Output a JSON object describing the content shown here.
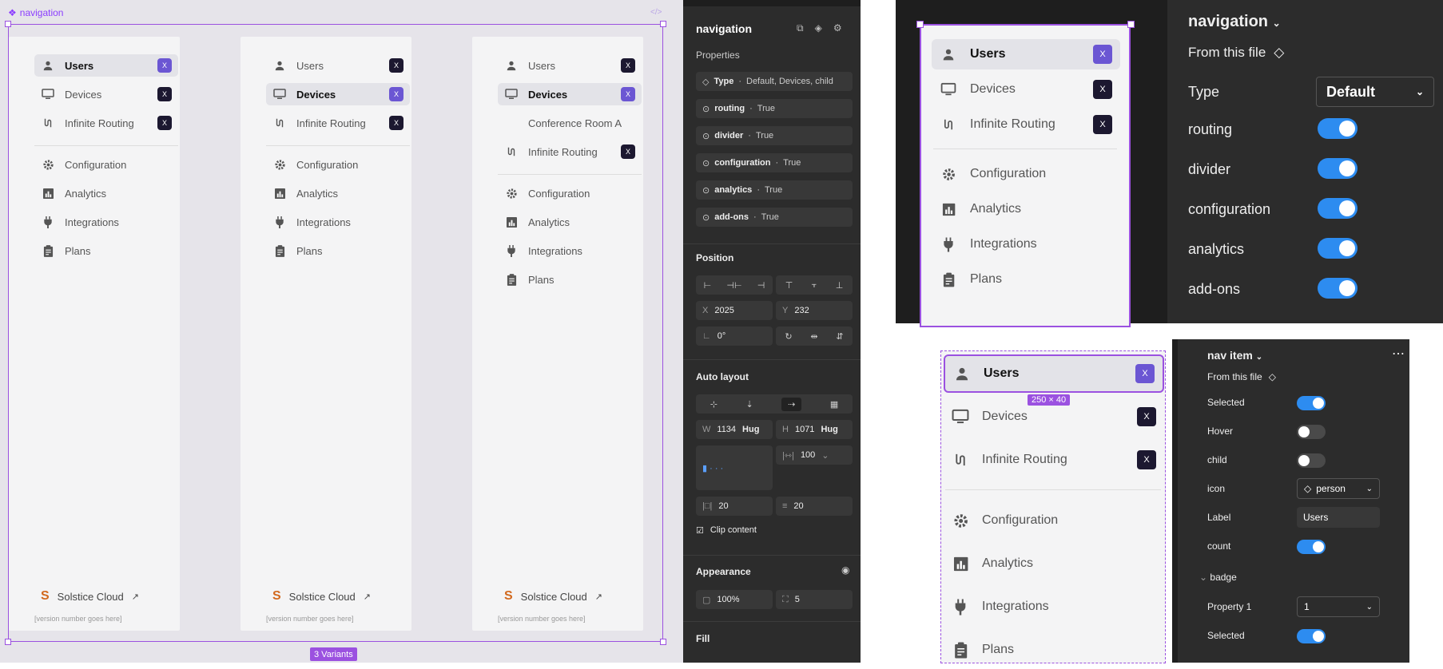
{
  "canvas": {
    "frame_name": "navigation",
    "variants_label": "3 Variants",
    "variants": [
      {
        "items": [
          {
            "label": "Users",
            "icon": "person-icon",
            "badge": "X",
            "selected": true
          },
          {
            "label": "Devices",
            "icon": "monitor-icon",
            "badge": "X",
            "selected": false
          },
          {
            "label": "Infinite Routing",
            "icon": "routing-icon",
            "badge": "X",
            "selected": false
          }
        ],
        "extra": []
      },
      {
        "items": [
          {
            "label": "Users",
            "icon": "person-icon",
            "badge": "X",
            "selected": false
          },
          {
            "label": "Devices",
            "icon": "monitor-icon",
            "badge": "X",
            "selected": true
          },
          {
            "label": "Infinite Routing",
            "icon": "routing-icon",
            "badge": "X",
            "selected": false
          }
        ]
      },
      {
        "items": [
          {
            "label": "Users",
            "icon": "person-icon",
            "badge": "X",
            "selected": false
          },
          {
            "label": "Devices",
            "icon": "monitor-icon",
            "badge": "X",
            "selected": true
          },
          {
            "label": "Conference Room A",
            "icon": "",
            "badge": "",
            "selected": false
          },
          {
            "label": "Infinite Routing",
            "icon": "routing-icon",
            "badge": "X",
            "selected": false
          }
        ]
      }
    ],
    "secondary_items": [
      {
        "label": "Configuration",
        "icon": "gear-icon"
      },
      {
        "label": "Analytics",
        "icon": "analytics-icon"
      },
      {
        "label": "Integrations",
        "icon": "plug-icon"
      },
      {
        "label": "Plans",
        "icon": "clipboard-icon"
      }
    ],
    "footer_brand": "Solstice Cloud",
    "version_text": "[version number goes here]"
  },
  "inspector": {
    "title": "navigation",
    "properties_heading": "Properties",
    "properties": [
      {
        "key": "Type",
        "value": "Default, Devices, child",
        "icon": "diamond-icon"
      },
      {
        "key": "routing",
        "value": "True",
        "icon": "toggle-icon"
      },
      {
        "key": "divider",
        "value": "True",
        "icon": "toggle-icon"
      },
      {
        "key": "configuration",
        "value": "True",
        "icon": "toggle-icon"
      },
      {
        "key": "analytics",
        "value": "True",
        "icon": "toggle-icon"
      },
      {
        "key": "add-ons",
        "value": "True",
        "icon": "toggle-icon"
      }
    ],
    "position_heading": "Position",
    "x_label": "X",
    "x_value": "2025",
    "y_label": "Y",
    "y_value": "232",
    "rotation": "0°",
    "auto_layout_heading": "Auto layout",
    "w_label": "W",
    "w_value": "1134",
    "w_mode": "Hug",
    "h_label": "H",
    "h_value": "1071",
    "h_mode": "Hug",
    "gap_value": "100",
    "pad_h": "20",
    "pad_v": "20",
    "clip_content": "Clip content",
    "appearance_heading": "Appearance",
    "opacity": "100%",
    "radius": "5",
    "fill_heading": "Fill"
  },
  "zoom_a": {
    "items": [
      {
        "label": "Users",
        "icon": "person-icon",
        "badge": "X",
        "selected": true
      },
      {
        "label": "Devices",
        "icon": "monitor-icon",
        "badge": "X"
      },
      {
        "label": "Infinite Routing",
        "icon": "routing-icon",
        "badge": "X"
      }
    ],
    "secondary": [
      {
        "label": "Configuration",
        "icon": "gear-icon"
      },
      {
        "label": "Analytics",
        "icon": "analytics-icon"
      },
      {
        "label": "Integrations",
        "icon": "plug-icon"
      },
      {
        "label": "Plans",
        "icon": "clipboard-icon"
      }
    ],
    "panel_title": "navigation",
    "from_file": "From this file",
    "type_label": "Type",
    "type_value": "Default",
    "toggles": [
      {
        "label": "routing",
        "on": true
      },
      {
        "label": "divider",
        "on": true
      },
      {
        "label": "configuration",
        "on": true
      },
      {
        "label": "analytics",
        "on": true
      },
      {
        "label": "add-ons",
        "on": true
      }
    ]
  },
  "zoom_b": {
    "items": [
      {
        "label": "Users",
        "icon": "person-icon",
        "badge": "X",
        "selected": true
      },
      {
        "label": "Devices",
        "icon": "monitor-icon",
        "badge": "X"
      },
      {
        "label": "Infinite Routing",
        "icon": "routing-icon",
        "badge": "X"
      }
    ],
    "secondary": [
      {
        "label": "Configuration",
        "icon": "gear-icon"
      },
      {
        "label": "Analytics",
        "icon": "analytics-icon"
      },
      {
        "label": "Integrations",
        "icon": "plug-icon"
      },
      {
        "label": "Plans",
        "icon": "clipboard-icon"
      }
    ],
    "size_badge": "250 × 40",
    "panel_title": "nav item",
    "from_file": "From this file",
    "rows": [
      {
        "label": "Selected",
        "kind": "toggle",
        "on": true
      },
      {
        "label": "Hover",
        "kind": "toggle",
        "on": false
      },
      {
        "label": "child",
        "kind": "toggle",
        "on": false
      },
      {
        "label": "icon",
        "kind": "select",
        "value": "person"
      },
      {
        "label": "Label",
        "kind": "text",
        "value": "Users"
      },
      {
        "label": "count",
        "kind": "toggle",
        "on": true
      }
    ],
    "badge_heading": "badge",
    "badge_rows": [
      {
        "label": "Property 1",
        "kind": "select",
        "value": "1"
      },
      {
        "label": "Selected",
        "kind": "toggle",
        "on": true
      }
    ]
  },
  "colors": {
    "accent": "#9b51e0",
    "badge_dark": "#1c1830",
    "badge_selected": "#6b56d3",
    "toggle_on": "#2d8cf0"
  }
}
